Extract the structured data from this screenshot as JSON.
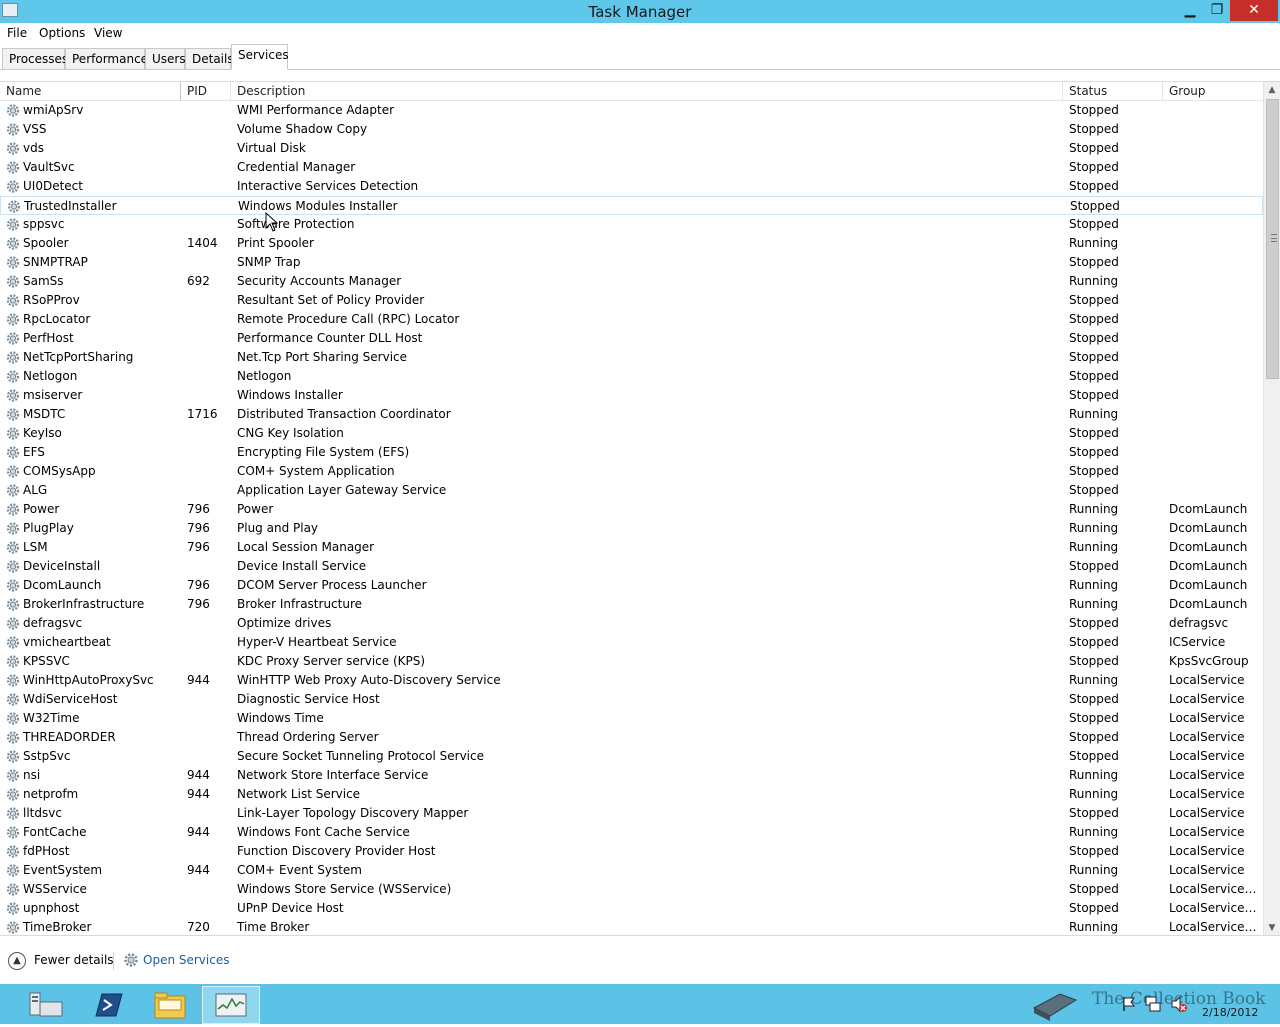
{
  "window": {
    "title": "Task Manager",
    "minimize": "▁",
    "maximize": "❐",
    "close": "✕"
  },
  "menu": [
    "File",
    "Options",
    "View"
  ],
  "tabs": [
    "Processes",
    "Performance",
    "Users",
    "Details",
    "Services"
  ],
  "active_tab": "Services",
  "columns": {
    "name": "Name",
    "pid": "PID",
    "description": "Description",
    "status": "Status",
    "group": "Group"
  },
  "rows": [
    [
      "wmiApSrv",
      "",
      "WMI Performance Adapter",
      "Stopped",
      ""
    ],
    [
      "VSS",
      "",
      "Volume Shadow Copy",
      "Stopped",
      ""
    ],
    [
      "vds",
      "",
      "Virtual Disk",
      "Stopped",
      ""
    ],
    [
      "VaultSvc",
      "",
      "Credential Manager",
      "Stopped",
      ""
    ],
    [
      "UI0Detect",
      "",
      "Interactive Services Detection",
      "Stopped",
      ""
    ],
    [
      "TrustedInstaller",
      "",
      "Windows Modules Installer",
      "Stopped",
      ""
    ],
    [
      "sppsvc",
      "",
      "Software Protection",
      "Stopped",
      ""
    ],
    [
      "Spooler",
      "1404",
      "Print Spooler",
      "Running",
      ""
    ],
    [
      "SNMPTRAP",
      "",
      "SNMP Trap",
      "Stopped",
      ""
    ],
    [
      "SamSs",
      "692",
      "Security Accounts Manager",
      "Running",
      ""
    ],
    [
      "RSoPProv",
      "",
      "Resultant Set of Policy Provider",
      "Stopped",
      ""
    ],
    [
      "RpcLocator",
      "",
      "Remote Procedure Call (RPC) Locator",
      "Stopped",
      ""
    ],
    [
      "PerfHost",
      "",
      "Performance Counter DLL Host",
      "Stopped",
      ""
    ],
    [
      "NetTcpPortSharing",
      "",
      "Net.Tcp Port Sharing Service",
      "Stopped",
      ""
    ],
    [
      "Netlogon",
      "",
      "Netlogon",
      "Stopped",
      ""
    ],
    [
      "msiserver",
      "",
      "Windows Installer",
      "Stopped",
      ""
    ],
    [
      "MSDTC",
      "1716",
      "Distributed Transaction Coordinator",
      "Running",
      ""
    ],
    [
      "KeyIso",
      "",
      "CNG Key Isolation",
      "Stopped",
      ""
    ],
    [
      "EFS",
      "",
      "Encrypting File System (EFS)",
      "Stopped",
      ""
    ],
    [
      "COMSysApp",
      "",
      "COM+ System Application",
      "Stopped",
      ""
    ],
    [
      "ALG",
      "",
      "Application Layer Gateway Service",
      "Stopped",
      ""
    ],
    [
      "Power",
      "796",
      "Power",
      "Running",
      "DcomLaunch"
    ],
    [
      "PlugPlay",
      "796",
      "Plug and Play",
      "Running",
      "DcomLaunch"
    ],
    [
      "LSM",
      "796",
      "Local Session Manager",
      "Running",
      "DcomLaunch"
    ],
    [
      "DeviceInstall",
      "",
      "Device Install Service",
      "Stopped",
      "DcomLaunch"
    ],
    [
      "DcomLaunch",
      "796",
      "DCOM Server Process Launcher",
      "Running",
      "DcomLaunch"
    ],
    [
      "BrokerInfrastructure",
      "796",
      "Broker Infrastructure",
      "Running",
      "DcomLaunch"
    ],
    [
      "defragsvc",
      "",
      "Optimize drives",
      "Stopped",
      "defragsvc"
    ],
    [
      "vmicheartbeat",
      "",
      "Hyper-V Heartbeat Service",
      "Stopped",
      "ICService"
    ],
    [
      "KPSSVC",
      "",
      "KDC Proxy Server service (KPS)",
      "Stopped",
      "KpsSvcGroup"
    ],
    [
      "WinHttpAutoProxySvc",
      "944",
      "WinHTTP Web Proxy Auto-Discovery Service",
      "Running",
      "LocalService"
    ],
    [
      "WdiServiceHost",
      "",
      "Diagnostic Service Host",
      "Stopped",
      "LocalService"
    ],
    [
      "W32Time",
      "",
      "Windows Time",
      "Stopped",
      "LocalService"
    ],
    [
      "THREADORDER",
      "",
      "Thread Ordering Server",
      "Stopped",
      "LocalService"
    ],
    [
      "SstpSvc",
      "",
      "Secure Socket Tunneling Protocol Service",
      "Stopped",
      "LocalService"
    ],
    [
      "nsi",
      "944",
      "Network Store Interface Service",
      "Running",
      "LocalService"
    ],
    [
      "netprofm",
      "944",
      "Network List Service",
      "Running",
      "LocalService"
    ],
    [
      "lltdsvc",
      "",
      "Link-Layer Topology Discovery Mapper",
      "Stopped",
      "LocalService"
    ],
    [
      "FontCache",
      "944",
      "Windows Font Cache Service",
      "Running",
      "LocalService"
    ],
    [
      "fdPHost",
      "",
      "Function Discovery Provider Host",
      "Stopped",
      "LocalService"
    ],
    [
      "EventSystem",
      "944",
      "COM+ Event System",
      "Running",
      "LocalService"
    ],
    [
      "WSService",
      "",
      "Windows Store Service (WSService)",
      "Stopped",
      "LocalServiceA..."
    ],
    [
      "upnphost",
      "",
      "UPnP Device Host",
      "Stopped",
      "LocalServiceA..."
    ],
    [
      "TimeBroker",
      "720",
      "Time Broker",
      "Running",
      "LocalServiceA..."
    ]
  ],
  "selected_row": "TrustedInstaller",
  "footer": {
    "fewer_details": "Fewer details",
    "open_services": "Open Services"
  },
  "tray": {
    "watermark": "The Collection Book",
    "date": "2/18/2012"
  },
  "colors": {
    "titlebar": "#5fc8ea",
    "taskbar": "#5cc2e6",
    "close": "#c7302a",
    "link": "#1a5e9f"
  }
}
